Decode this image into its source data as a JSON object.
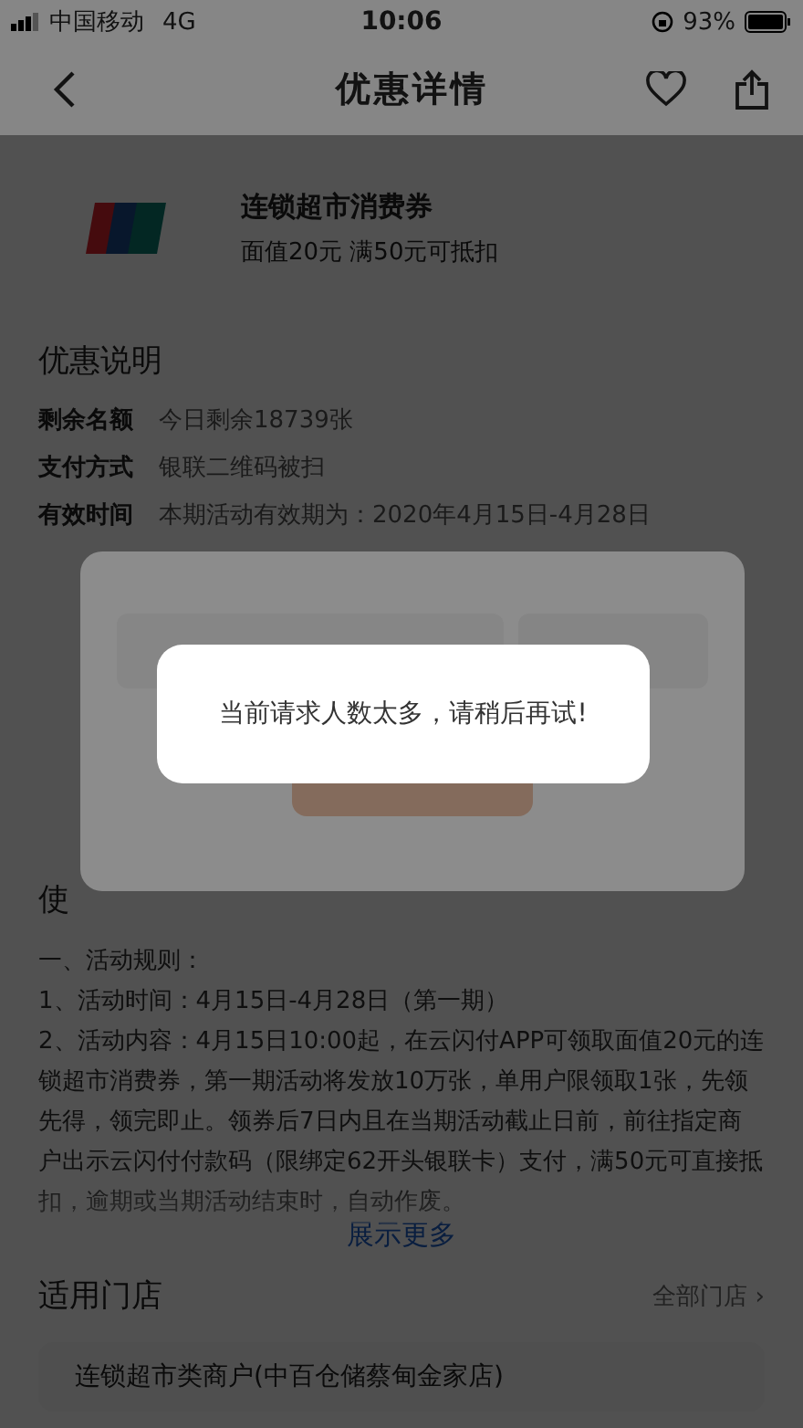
{
  "status_bar": {
    "carrier": "中国移动",
    "network": "4G",
    "time": "10:06",
    "battery": "93%"
  },
  "nav": {
    "title": "优惠详情"
  },
  "coupon": {
    "title": "连锁超市消费券",
    "subtitle": "面值20元 满50元可抵扣"
  },
  "info": {
    "heading": "优惠说明",
    "rows": [
      {
        "label": "剩余名额",
        "value": "今日剩余18739张"
      },
      {
        "label": "支付方式",
        "value": "银联二维码被扫"
      },
      {
        "label": "有效时间",
        "value": "本期活动有效期为：2020年4月15日-4月28日"
      }
    ]
  },
  "usage": {
    "heading": "使",
    "rules": [
      "一、活动规则：",
      "1、活动时间：4月15日-4月28日（第一期）",
      "2、活动内容：4月15日10:00起，在云闪付APP可领取面值20元的连锁超市消费券，第一期活动将发放10万张，单用户限领取1张，先领先得，领完即止。领券后7日内且在当期活动截止日前，前往指定商户出示云闪付付款码（限绑定62开头银联卡）支付，满50元可直接抵扣，逾期或当期活动结束时，自动作废。"
    ],
    "more": "展示更多"
  },
  "stores": {
    "heading": "适用门店",
    "all_link": "全部门店 ›",
    "items": [
      "连锁超市类商户(中百仓储蔡甸金家店)"
    ]
  },
  "toast": {
    "message": "当前请求人数太多，请稍后再试!"
  }
}
